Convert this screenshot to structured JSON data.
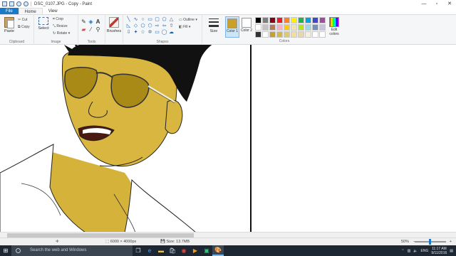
{
  "window": {
    "title": "DSC_0107.JPG - Copy - Paint",
    "minimize_glyph": "—",
    "maximize_glyph": "▫",
    "close_glyph": "✕"
  },
  "tabs": [
    {
      "label": "File"
    },
    {
      "label": "Home"
    },
    {
      "label": "View"
    }
  ],
  "ribbon": {
    "clipboard": {
      "paste": "Paste",
      "cut": "Cut",
      "copy": "Copy",
      "group": "Clipboard"
    },
    "image": {
      "select": "Select",
      "crop": "Crop",
      "resize": "Resize",
      "rotate": "Rotate",
      "group": "Image"
    },
    "tools": {
      "group": "Tools"
    },
    "brushes": {
      "label": "Brushes"
    },
    "shapes": {
      "outline": "Outline",
      "fill": "Fill",
      "group": "Shapes"
    },
    "size": {
      "label": "Size"
    },
    "color1": {
      "label": "Color 1",
      "value": "#c9a12a"
    },
    "color2": {
      "label": "Color 2",
      "value": "#ffffff"
    },
    "colors_group": "Colors",
    "edit_colors": "Edit colors",
    "palette": [
      "#000000",
      "#7f7f7f",
      "#880015",
      "#ed1c24",
      "#ff7f27",
      "#fff200",
      "#22b14c",
      "#00a2e8",
      "#3f48cc",
      "#a349a4",
      "#ffffff",
      "#c3c3c3",
      "#b97a57",
      "#ffaec9",
      "#ffc90e",
      "#efe4b0",
      "#b5e61d",
      "#99d9ea",
      "#7092be",
      "#c8bfe7",
      "#333333",
      "#ffffff",
      "#c9a12a",
      "#d6b64f",
      "#e0c870",
      "#f0de9a",
      "#ead7a8",
      "#f5f0d8",
      "#ffffff",
      "#ffffff"
    ]
  },
  "status": {
    "dimensions": "6000 × 4000px",
    "size": "Size: 13.7MB",
    "zoom": "50%"
  },
  "taskbar": {
    "search_placeholder": "Search the web and Windows",
    "language": "ENG",
    "time": "11:17 AM",
    "date": "9/11/2016"
  }
}
